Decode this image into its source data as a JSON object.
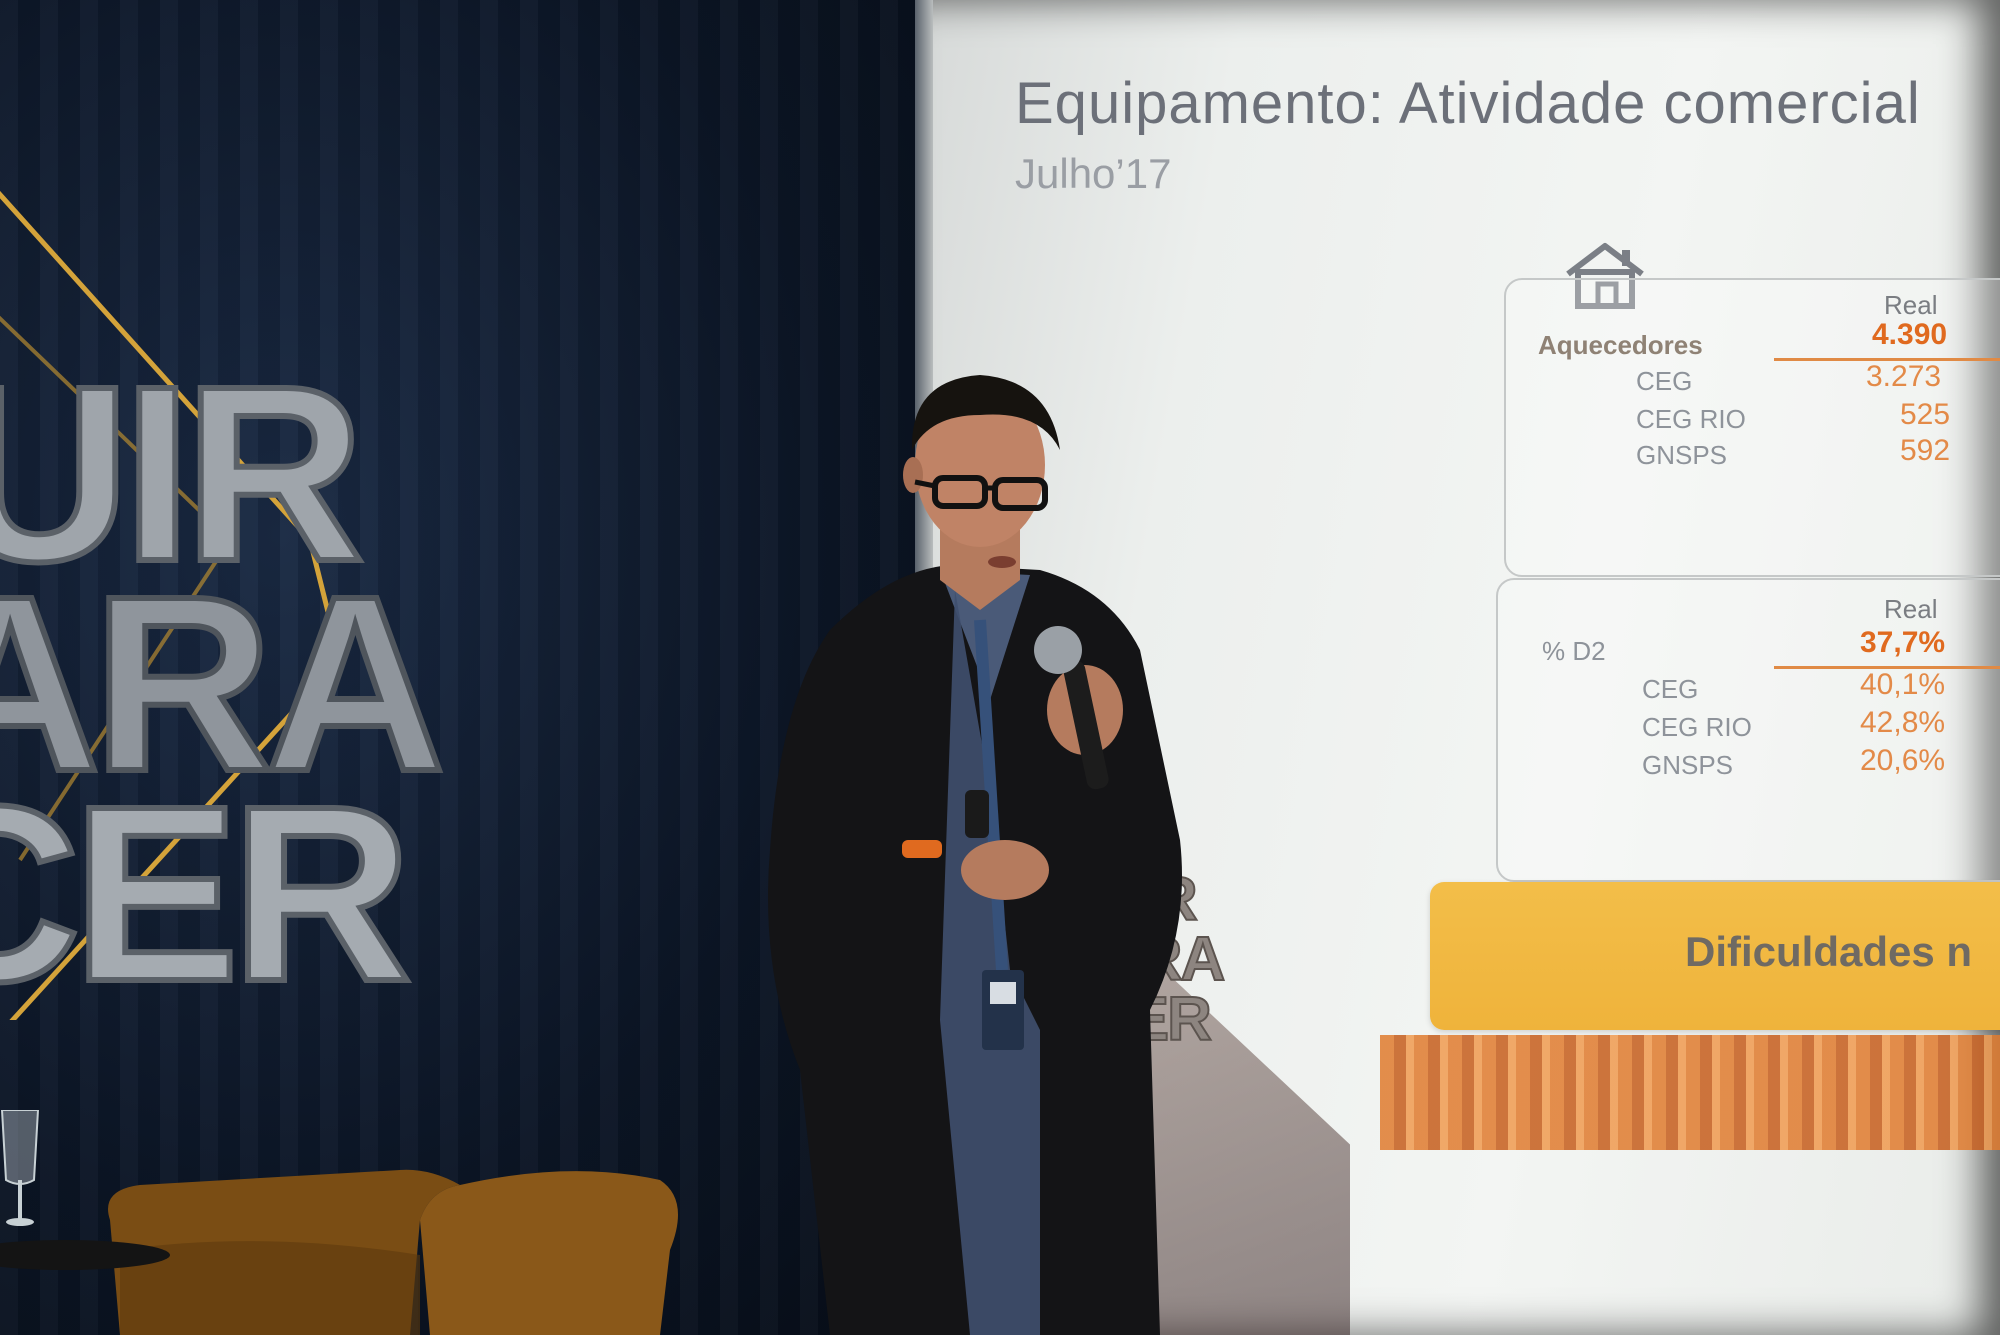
{
  "slide": {
    "title": "Equipamento: Atividade comercial",
    "subtitle": "Julho’17",
    "icon": "house-icon",
    "box1": {
      "column_header": "Real",
      "rows": [
        {
          "label": "Aquecedores",
          "value": "4.390"
        },
        {
          "label": "CEG",
          "value": "3.273"
        },
        {
          "label": "CEG RIO",
          "value": "525"
        },
        {
          "label": "GNSPS",
          "value": "592"
        }
      ]
    },
    "box2": {
      "column_header": "Real",
      "rows": [
        {
          "label": "% D2",
          "value": "37,7%"
        },
        {
          "label": "CEG",
          "value": "40,1%"
        },
        {
          "label": "CEG RIO",
          "value": "42,8%"
        },
        {
          "label": "GNSPS",
          "value": "20,6%"
        }
      ]
    },
    "banner": "Dificuldades n"
  },
  "backdrop": {
    "logo_lines": [
      "UIR",
      "ARA",
      "CER"
    ]
  },
  "slide_logo": {
    "lines": [
      "UIR",
      "ARA",
      "CER"
    ]
  },
  "colors": {
    "accent_orange": "#e06a1f",
    "banner_yellow": "#f3be49",
    "backdrop_navy": "#0c1626",
    "logo_gold": "#d4a33a"
  }
}
